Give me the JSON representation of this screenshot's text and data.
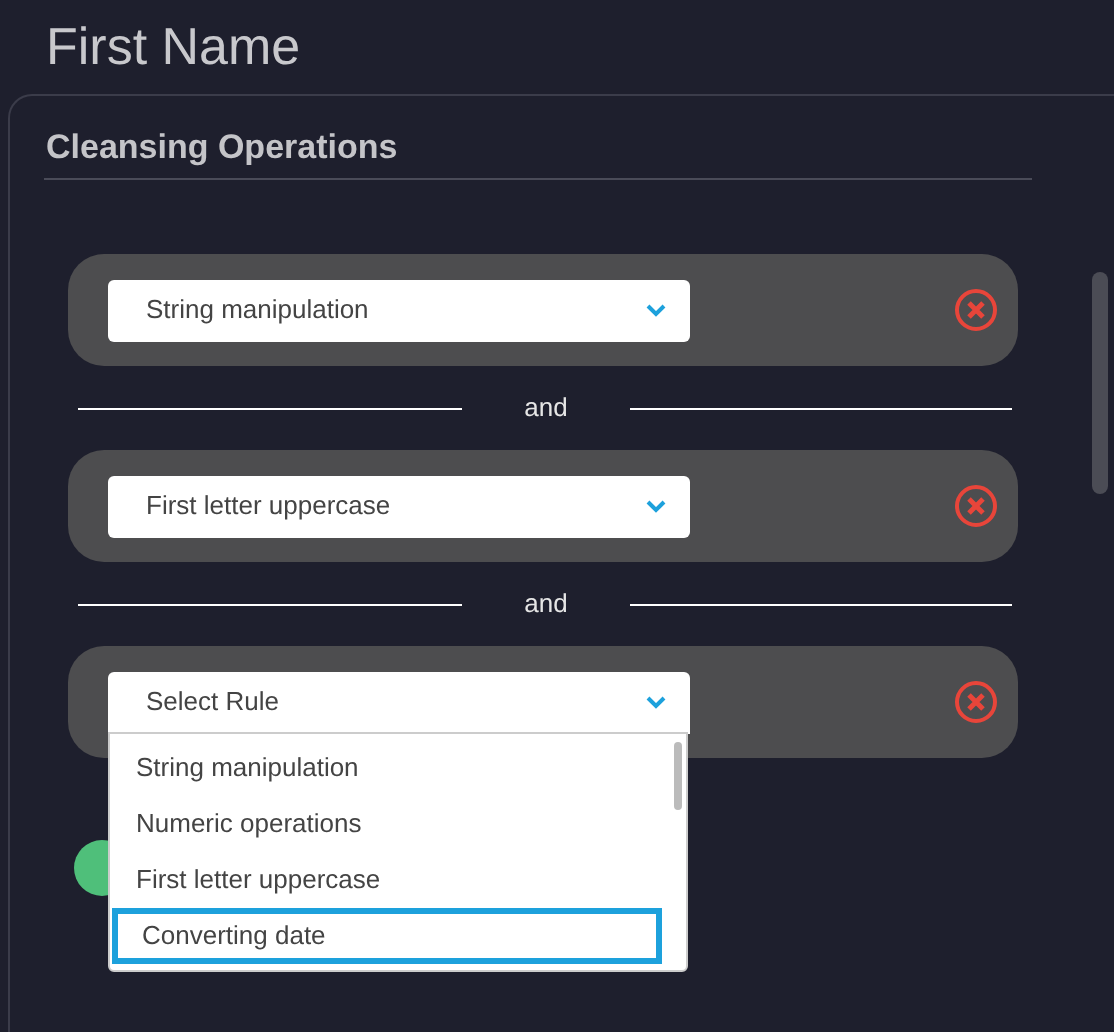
{
  "title": "First Name",
  "panel": {
    "title": "Cleansing Operations"
  },
  "rules": [
    {
      "value": "String manipulation",
      "open": false
    },
    {
      "connector": "and",
      "value": "First letter uppercase",
      "open": false
    },
    {
      "connector": "and",
      "placeholder": "Select Rule",
      "open": true
    }
  ],
  "dropdown_options": [
    {
      "label": "String manipulation",
      "selected": false
    },
    {
      "label": "Numeric operations",
      "selected": false
    },
    {
      "label": "First letter uppercase",
      "selected": false
    },
    {
      "label": "Converting date",
      "selected": true
    }
  ]
}
